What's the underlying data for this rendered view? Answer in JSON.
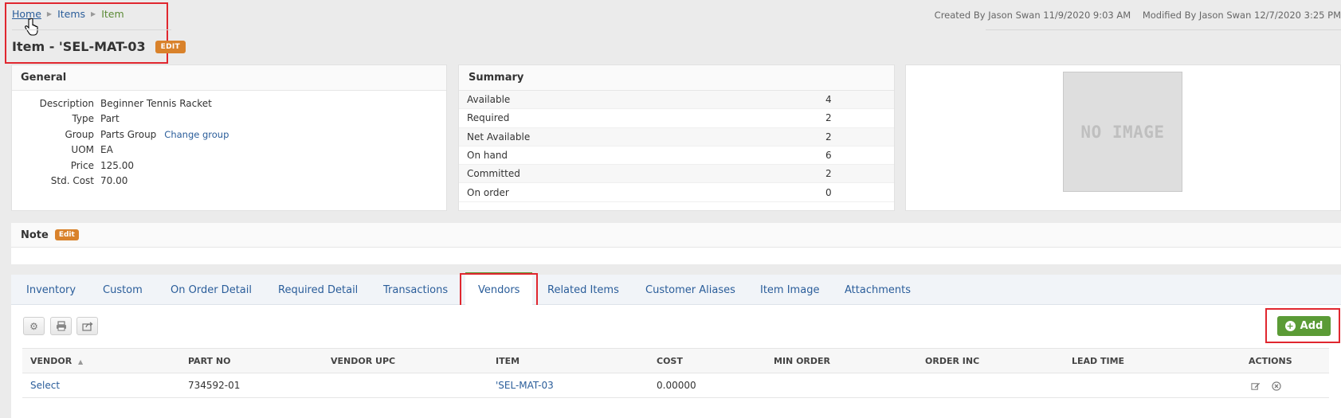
{
  "breadcrumb": {
    "home": "Home",
    "items": "Items",
    "current": "Item"
  },
  "header": {
    "title": "Item - 'SEL-MAT-03",
    "edit_label": "EDIT"
  },
  "meta": {
    "created": "Created By Jason Swan 11/9/2020 9:03 AM",
    "modified": "Modified By Jason Swan 12/7/2020 3:25 PM"
  },
  "general": {
    "title": "General",
    "rows": [
      {
        "label": "Description",
        "value": "Beginner Tennis Racket"
      },
      {
        "label": "Type",
        "value": "Part"
      },
      {
        "label": "Group",
        "value": "Parts Group",
        "link": "Change group"
      },
      {
        "label": "UOM",
        "value": "EA"
      },
      {
        "label": "Price",
        "value": "125.00"
      },
      {
        "label": "Std. Cost",
        "value": "70.00"
      }
    ]
  },
  "summary": {
    "title": "Summary",
    "rows": [
      {
        "label": "Available",
        "value": "4"
      },
      {
        "label": "Required",
        "value": "2"
      },
      {
        "label": "Net Available",
        "value": "2"
      },
      {
        "label": "On hand",
        "value": "6"
      },
      {
        "label": "Committed",
        "value": "2"
      },
      {
        "label": "On order",
        "value": "0"
      }
    ]
  },
  "image": {
    "placeholder": "NO IMAGE"
  },
  "note": {
    "title": "Note",
    "edit_label": "Edit"
  },
  "tabs": [
    "Inventory",
    "Custom",
    "On Order Detail",
    "Required Detail",
    "Transactions",
    "Vendors",
    "Related Items",
    "Customer Aliases",
    "Item Image",
    "Attachments"
  ],
  "active_tab": "Vendors",
  "toolbar": {
    "add_label": "Add"
  },
  "table": {
    "columns": [
      "VENDOR",
      "PART NO",
      "VENDOR UPC",
      "ITEM",
      "COST",
      "MIN ORDER",
      "ORDER INC",
      "LEAD TIME",
      "ACTIONS"
    ],
    "rows": [
      {
        "vendor": "Select",
        "part_no": "734592-01",
        "vendor_upc": "",
        "item": "'SEL-MAT-03",
        "cost": "0.00000",
        "min_order": "",
        "order_inc": "",
        "lead_time": ""
      }
    ]
  },
  "colors": {
    "accent_green": "#5b9b36",
    "badge_orange": "#d9822b",
    "link_blue": "#2a5d9a",
    "highlight_red": "#e0272f"
  }
}
